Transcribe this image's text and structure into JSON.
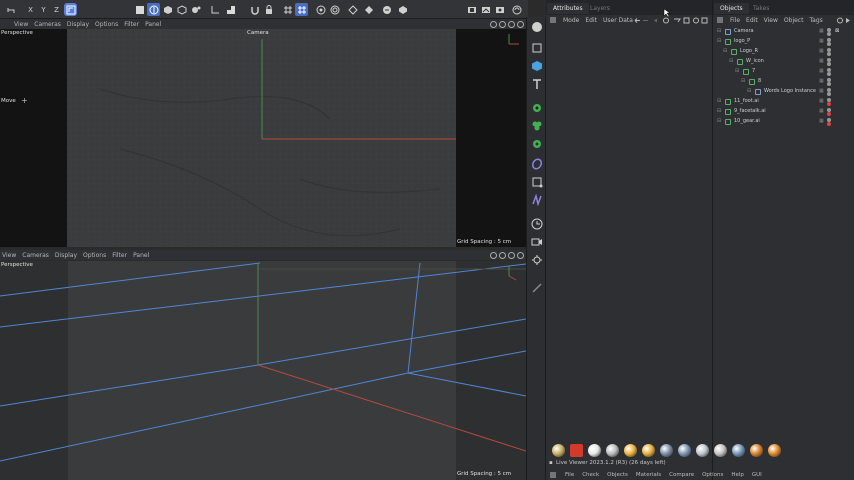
{
  "colors": {
    "accent": "#4a6ebf",
    "axis_red": "#b14a3f",
    "axis_green": "#4d8a4d",
    "grid_blue": "#4f86d6",
    "black_bar": "#131313"
  },
  "top_toolbar": {
    "icons": [
      "undo-icon",
      "redo-icon",
      "x-axis-lock",
      "y-axis-lock",
      "z-axis-lock",
      "coordinate-system-icon",
      "move-tool-icon",
      "live-select-icon",
      "cube-icon",
      "polygon-icon",
      "paint-icon",
      "workplane-icon",
      "snap-icon",
      "magnet-icon",
      "grid-icon",
      "render-region-icon",
      "render-view-icon",
      "render-settings-icon",
      "render-button-icon",
      "viewport-layout-icon",
      "picture-viewer-icon",
      "render-queue-icon",
      "layout-icon"
    ],
    "axes": [
      "X",
      "Y",
      "Z"
    ]
  },
  "viewport_top": {
    "menu": [
      "View",
      "Cameras",
      "Display",
      "Options",
      "Filter",
      "Panel"
    ],
    "projection": "Perspective",
    "camera": "Camera",
    "tool": "Move",
    "grid_spacing": "Grid Spacing : 5 cm"
  },
  "viewport_bottom": {
    "menu": [
      "View",
      "Cameras",
      "Display",
      "Options",
      "Filter",
      "Panel"
    ],
    "projection": "Perspective",
    "grid_spacing": "Grid Spacing : 5 cm"
  },
  "attributes": {
    "tabs": [
      "Attributes",
      "Layers"
    ],
    "menu": [
      "Mode",
      "Edit",
      "User Data"
    ]
  },
  "objects": {
    "tabs": [
      "Objects",
      "Takes"
    ],
    "menu": [
      "File",
      "Edit",
      "View",
      "Object",
      "Tags"
    ],
    "rows": [
      {
        "name": "Camera",
        "indent": 0
      },
      {
        "name": "logo_P",
        "indent": 0
      },
      {
        "name": "Logo_R",
        "indent": 1
      },
      {
        "name": "W_icon",
        "indent": 2
      },
      {
        "name": "7",
        "indent": 3
      },
      {
        "name": "8",
        "indent": 4
      },
      {
        "name": "Words Logo Instance",
        "indent": 5
      },
      {
        "name": "11_foot.ai",
        "indent": 0
      },
      {
        "name": "9_facetalk.ai",
        "indent": 0
      },
      {
        "name": "10_gear.ai",
        "indent": 0
      }
    ]
  },
  "materials": [
    "mat-1",
    "mat-2",
    "mat-3",
    "mat-4",
    "mat-5",
    "mat-6",
    "mat-7",
    "mat-8",
    "mat-9",
    "mat-10",
    "mat-11",
    "mat-12",
    "mat-13"
  ],
  "status": {
    "text": "Live Viewer 2023.1.2 (R3) (26 days left)"
  },
  "bottom_menu": [
    "File",
    "Check",
    "Objects",
    "Materials",
    "Compare",
    "Options",
    "Help",
    "GUI"
  ]
}
